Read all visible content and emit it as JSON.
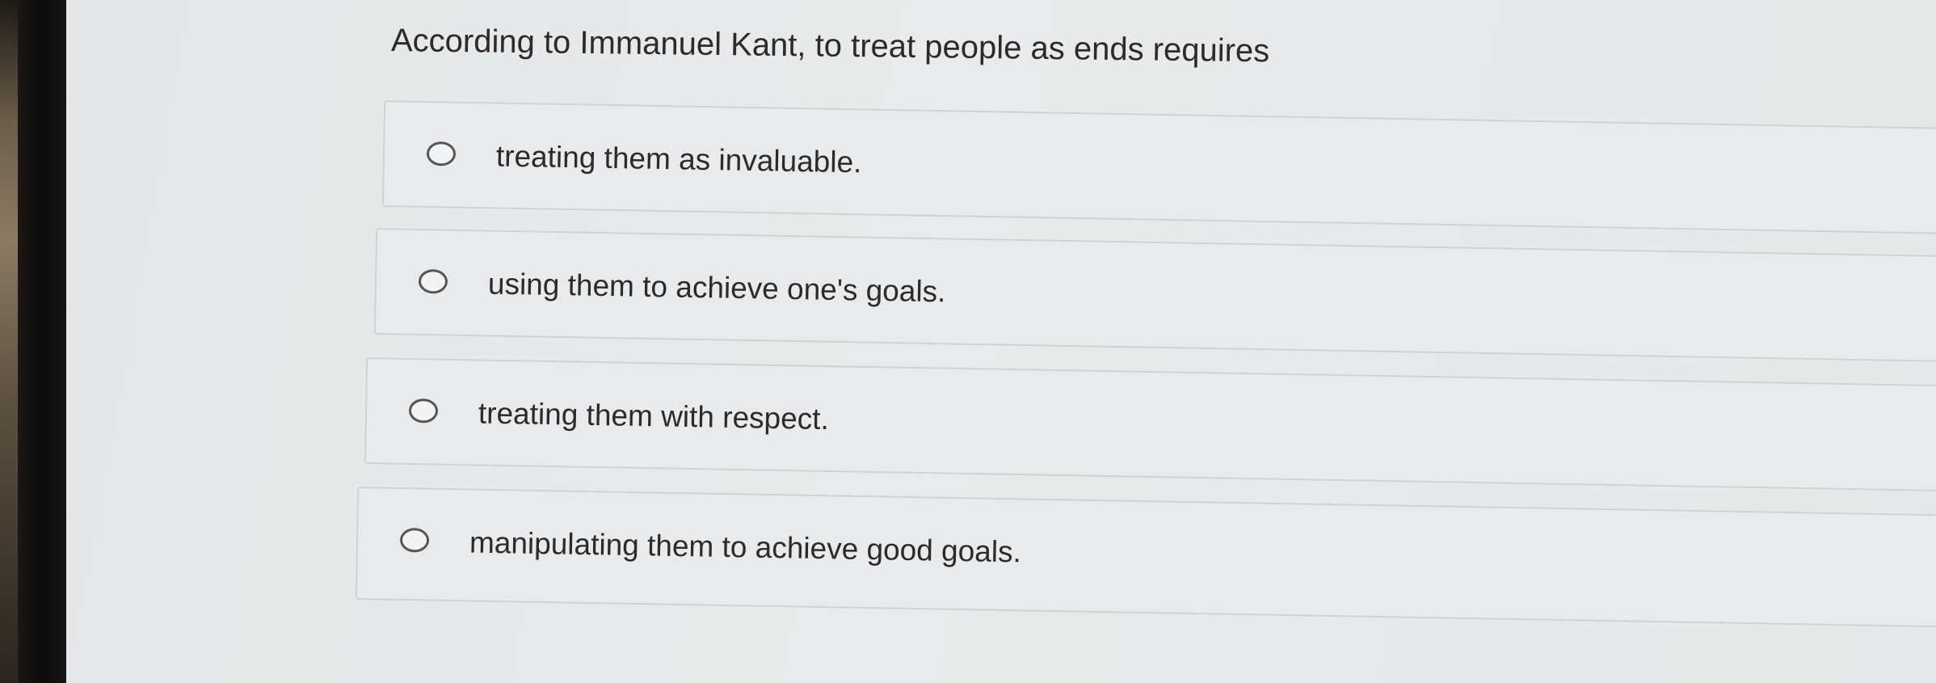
{
  "question": {
    "text": "According to Immanuel Kant, to treat people as ends requires"
  },
  "options": [
    {
      "label": "treating them as invaluable.",
      "selected": false
    },
    {
      "label": "using them to achieve one's goals.",
      "selected": false
    },
    {
      "label": "treating them with respect.",
      "selected": false
    },
    {
      "label": "manipulating them to achieve good goals.",
      "selected": false
    }
  ]
}
